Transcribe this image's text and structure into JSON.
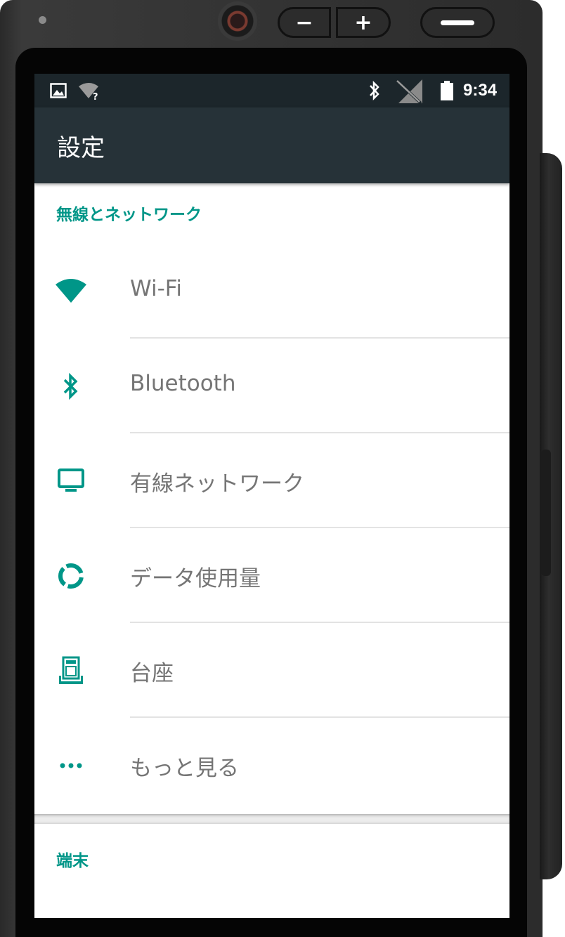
{
  "status_bar": {
    "time": "9:34",
    "icons": [
      "image-icon",
      "wifi-unknown-icon",
      "bluetooth-icon",
      "no-signal-icon",
      "battery-icon"
    ]
  },
  "app_bar": {
    "title": "設定"
  },
  "sections": [
    {
      "header": "無線とネットワーク",
      "items": [
        {
          "label": "Wi-Fi",
          "icon": "wifi-icon"
        },
        {
          "label": "Bluetooth",
          "icon": "bluetooth-icon"
        },
        {
          "label": "有線ネットワーク",
          "icon": "monitor-icon"
        },
        {
          "label": "データ使用量",
          "icon": "data-usage-icon"
        },
        {
          "label": "台座",
          "icon": "dock-icon"
        },
        {
          "label": "もっと見る",
          "icon": "more-dots-icon"
        }
      ]
    },
    {
      "header": "端末",
      "items": []
    }
  ],
  "colors": {
    "accent": "#009688",
    "app_bar": "#263238",
    "status_bar": "#1c262b",
    "item_text": "#757575"
  }
}
